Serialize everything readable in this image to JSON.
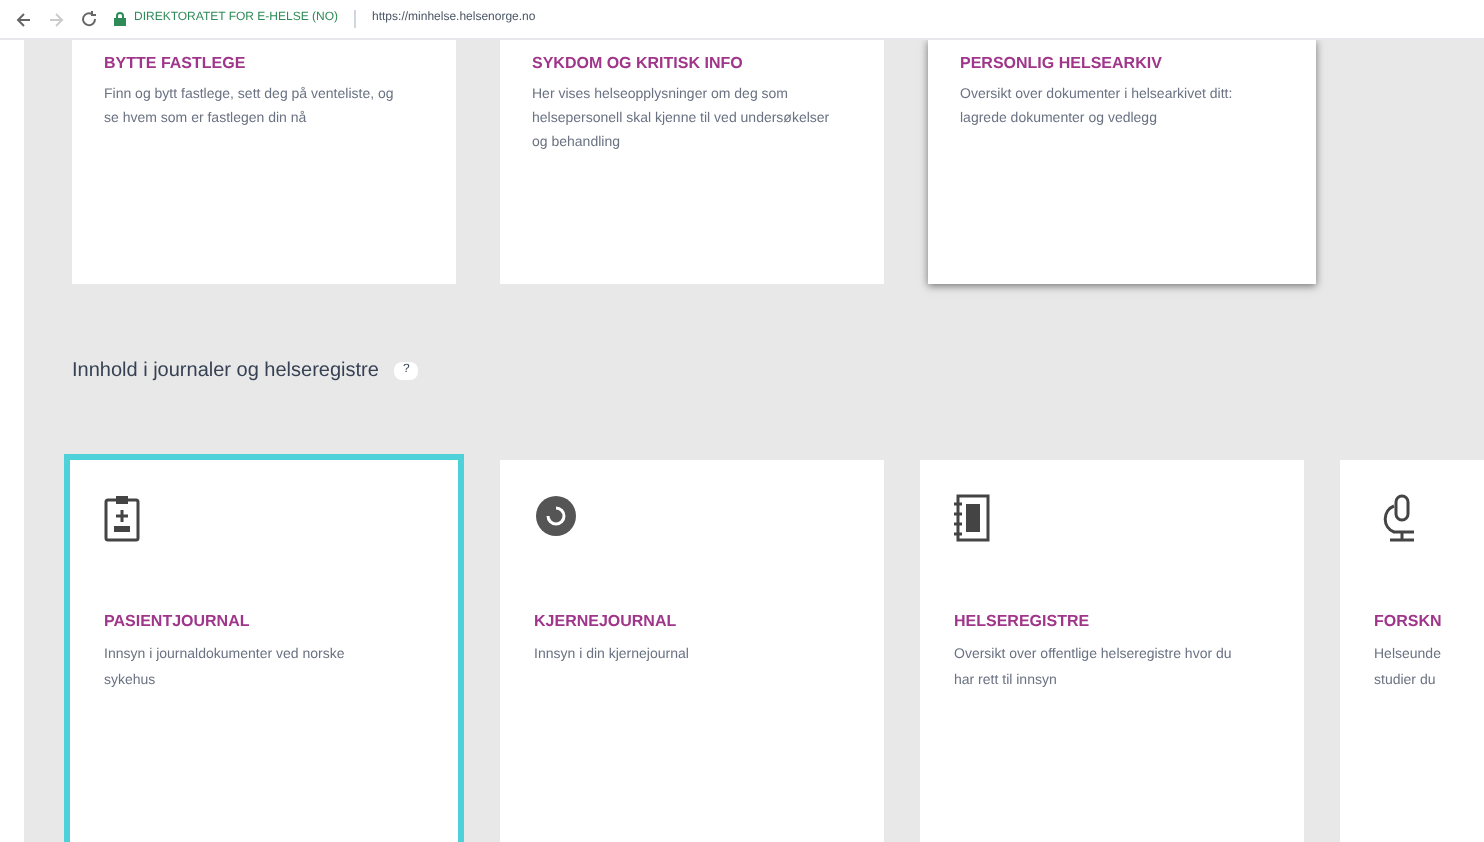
{
  "browser": {
    "site_identity": "DIREKTORATET FOR E-HELSE (NO)",
    "url": "https://minhelse.helsenorge.no"
  },
  "top_cards": [
    {
      "title": "BYTTE FASTLEGE",
      "description": "Finn og bytt fastlege, sett deg på venteliste, og se hvem som er fastlegen din nå",
      "hovered": false
    },
    {
      "title": "SYKDOM OG KRITISK INFO",
      "description": "Her vises helseopplysninger om deg som helsepersonell skal kjenne til ved undersøkelser og behandling",
      "hovered": false
    },
    {
      "title": "PERSONLIG HELSEARKIV",
      "description": "Oversikt over dokumenter i helsearkivet ditt: lagrede dokumenter og vedlegg",
      "hovered": true
    }
  ],
  "section": {
    "heading": "Innhold i journaler og helseregistre",
    "help_badge": "?"
  },
  "cards": [
    {
      "kind": "clipboard",
      "title": "PASIENTJOURNAL",
      "description": "Innsyn i journaldokumenter ved norske sykehus",
      "selected": true
    },
    {
      "kind": "circle",
      "title": "KJERNEJOURNAL",
      "description": "Innsyn i din kjernejournal",
      "selected": false
    },
    {
      "kind": "binder",
      "title": "HELSEREGISTRE",
      "description": "Oversikt over offentlige helseregistre hvor du har rett til innsyn",
      "selected": false
    },
    {
      "kind": "microscope",
      "title": "FORSKN",
      "description": "Helseunde studier du",
      "selected": false
    }
  ]
}
